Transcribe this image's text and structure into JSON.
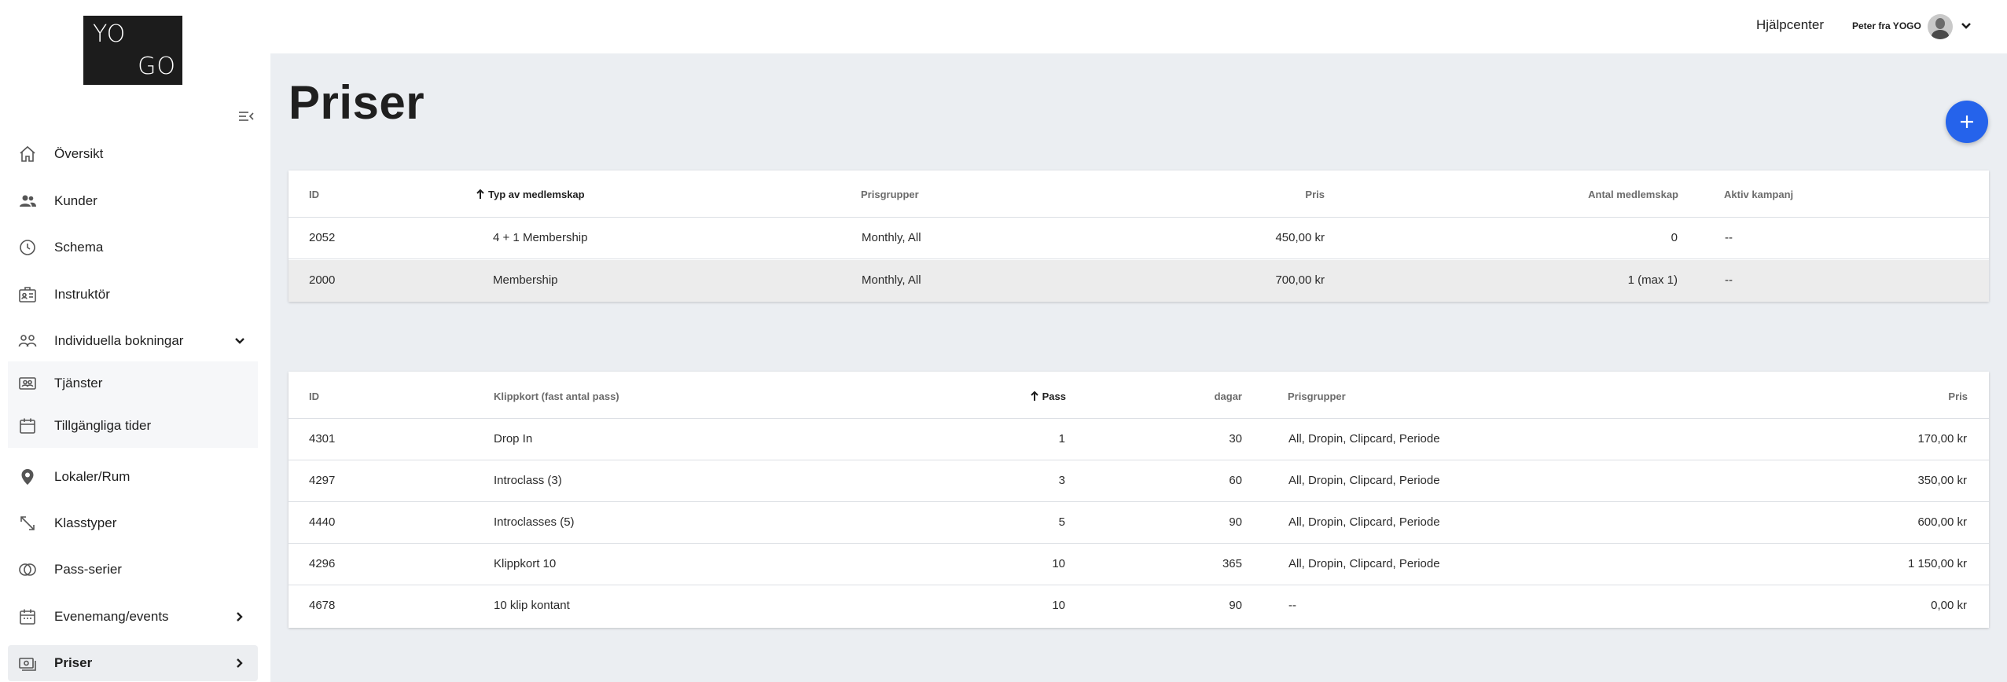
{
  "logo": {
    "line1": "YO",
    "line2": "GO"
  },
  "sidebar": {
    "items": [
      {
        "label": "Översikt",
        "icon": "home-icon"
      },
      {
        "label": "Kunder",
        "icon": "users-icon"
      },
      {
        "label": "Schema",
        "icon": "clock-icon"
      },
      {
        "label": "Instruktör",
        "icon": "id-card-icon"
      },
      {
        "label": "Individuella bokningar",
        "icon": "people-icon",
        "expanded": true
      },
      {
        "label": "Tjänster",
        "icon": "service-card-icon"
      },
      {
        "label": "Tillgängliga tider",
        "icon": "calendar-icon"
      },
      {
        "label": "Lokaler/Rum",
        "icon": "location-pin-icon"
      },
      {
        "label": "Klasstyper",
        "icon": "arrows-diagonal-icon"
      },
      {
        "label": "Pass-serier",
        "icon": "rings-icon"
      },
      {
        "label": "Evenemang/events",
        "icon": "calendar-icon"
      },
      {
        "label": "Priser",
        "icon": "cash-icon",
        "active": true
      }
    ]
  },
  "header": {
    "help_label": "Hjälpcenter",
    "user_name": "Peter fra YOGO"
  },
  "main": {
    "title": "Priser",
    "membership_table": {
      "columns": [
        "ID",
        "Typ av medlemskap",
        "Prisgrupper",
        "Pris",
        "Antal medlemskap",
        "Aktiv kampanj"
      ],
      "rows": [
        [
          "2052",
          "4 + 1 Membership",
          "Monthly, All",
          "450,00 kr",
          "0",
          "--"
        ],
        [
          "2000",
          "Membership",
          "Monthly, All",
          "700,00 kr",
          "1 (max 1)",
          "--"
        ]
      ]
    },
    "clipcard_table": {
      "columns": [
        "ID",
        "Klippkort (fast antal pass)",
        "Pass",
        "dagar",
        "Prisgrupper",
        "Pris"
      ],
      "rows": [
        [
          "4301",
          "Drop In",
          "1",
          "30",
          "All, Dropin, Clipcard, Periode",
          "170,00 kr"
        ],
        [
          "4297",
          "Introclass (3)",
          "3",
          "60",
          "All, Dropin, Clipcard, Periode",
          "350,00 kr"
        ],
        [
          "4440",
          "Introclasses (5)",
          "5",
          "90",
          "All, Dropin, Clipcard, Periode",
          "600,00 kr"
        ],
        [
          "4296",
          "Klippkort 10",
          "10",
          "365",
          "All, Dropin, Clipcard, Periode",
          "1 150,00 kr"
        ],
        [
          "4678",
          "10 klip kontant",
          "10",
          "90",
          "--",
          "0,00 kr"
        ]
      ]
    }
  },
  "colors": {
    "accent": "#2563eb",
    "background": "#ebeef2",
    "highlight_row": "#ececec"
  }
}
